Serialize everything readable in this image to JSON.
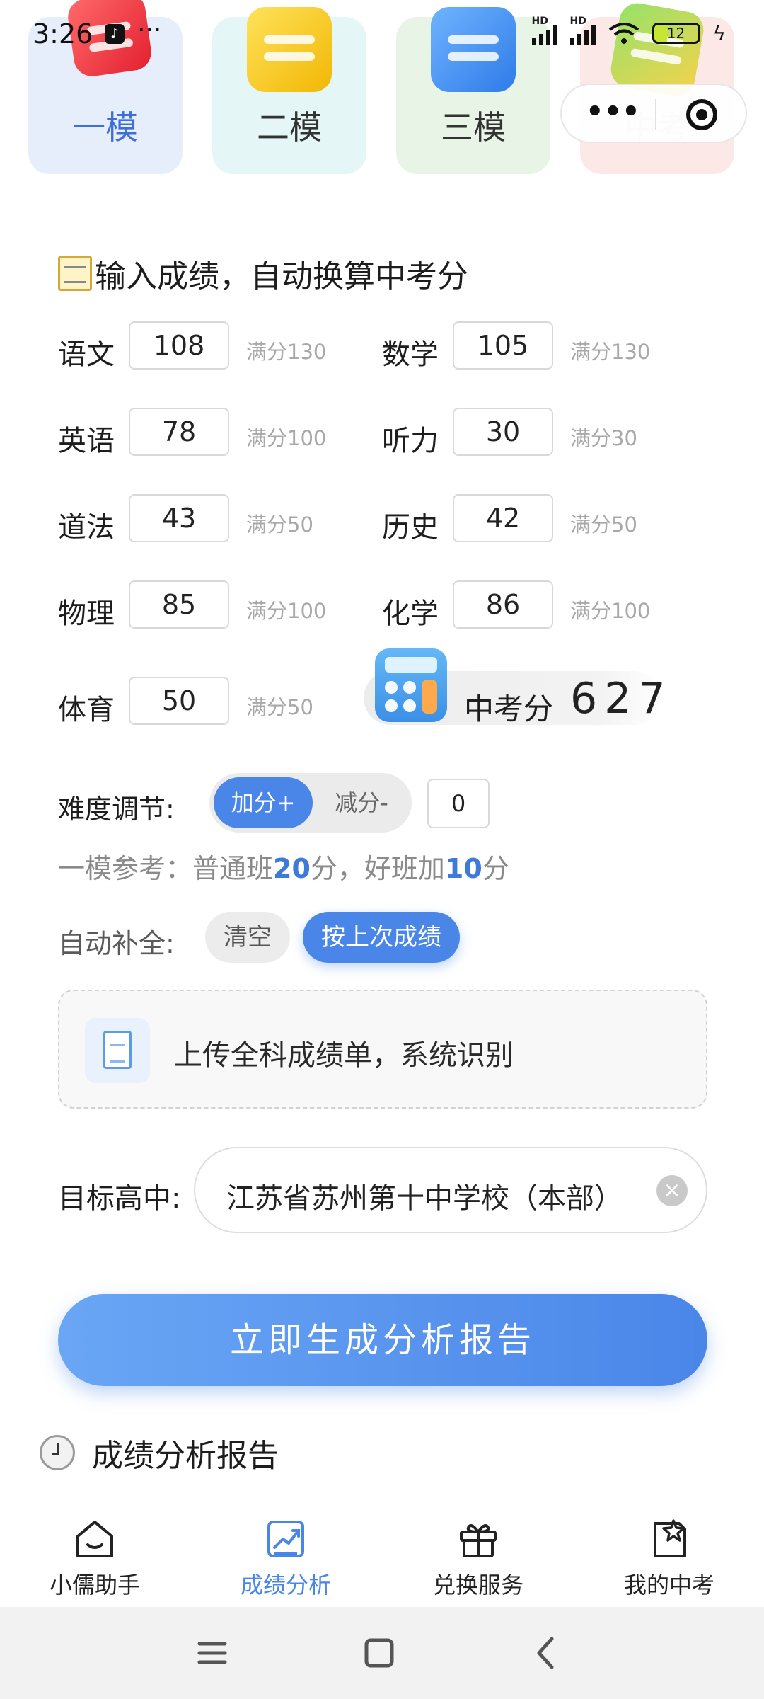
{
  "status_bar": {
    "time": "3:26",
    "more": "···",
    "signal_label": "HD",
    "battery": "12"
  },
  "exam_tabs": [
    {
      "label": "一模",
      "active": true,
      "color": "#3e6fd8"
    },
    {
      "label": "二模"
    },
    {
      "label": "三模"
    },
    {
      "label": "中考"
    }
  ],
  "capsule": {
    "more": "•••"
  },
  "heading": "输入成绩，自动换算中考分",
  "subjects": [
    {
      "name": "语文",
      "score": "108",
      "full": "满分130"
    },
    {
      "name": "数学",
      "score": "105",
      "full": "满分130"
    },
    {
      "name": "英语",
      "score": "78",
      "full": "满分100"
    },
    {
      "name": "听力",
      "score": "30",
      "full": "满分30"
    },
    {
      "name": "道法",
      "score": "43",
      "full": "满分50"
    },
    {
      "name": "历史",
      "score": "42",
      "full": "满分50"
    },
    {
      "name": "物理",
      "score": "85",
      "full": "满分100"
    },
    {
      "name": "化学",
      "score": "86",
      "full": "满分100"
    },
    {
      "name": "体育",
      "score": "50",
      "full": "满分50"
    }
  ],
  "total": {
    "label": "中考分",
    "value": "627"
  },
  "difficulty": {
    "label": "难度调节:",
    "plus": "加分+",
    "minus": "减分-",
    "value": "0"
  },
  "reference": {
    "prefix": "一模参考：普通班",
    "normal": "20",
    "mid": "分，好班加",
    "good": "10",
    "suffix": "分"
  },
  "autofill": {
    "label": "自动补全:",
    "clear": "清空",
    "last": "按上次成绩"
  },
  "upload": {
    "text": "上传全科成绩单，系统识别"
  },
  "target_school": {
    "label": "目标高中:",
    "value": "江苏省苏州第十中学校（本部）",
    "clear_icon": "×"
  },
  "generate_button": "立即生成分析报告",
  "report_title": "成绩分析报告",
  "tabbar": [
    {
      "label": "小儒助手",
      "icon": "home-smile-icon"
    },
    {
      "label": "成绩分析",
      "icon": "chart-trend-icon",
      "active": true
    },
    {
      "label": "兑换服务",
      "icon": "gift-icon"
    },
    {
      "label": "我的中考",
      "icon": "star-note-icon"
    }
  ],
  "colors": {
    "primary": "#4a86e8",
    "accent_text": "#3e7ad9",
    "muted": "#a8a8a8"
  }
}
